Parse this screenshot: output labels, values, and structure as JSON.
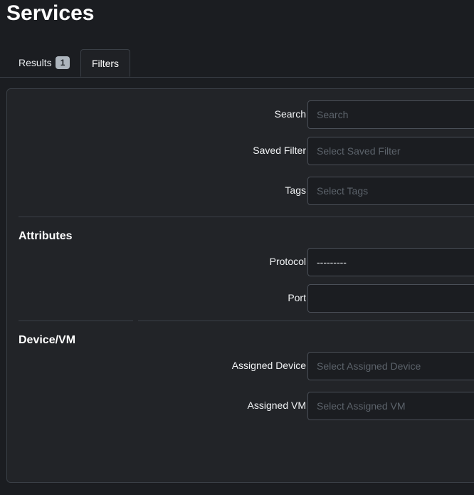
{
  "page": {
    "title": "Services"
  },
  "tabs": [
    {
      "label": "Results",
      "badge": "1"
    },
    {
      "label": "Filters"
    }
  ],
  "filters": {
    "search": {
      "label": "Search",
      "placeholder": "Search"
    },
    "saved_filter": {
      "label": "Saved Filter",
      "placeholder": "Select Saved Filter"
    },
    "tags": {
      "label": "Tags",
      "placeholder": "Select Tags"
    }
  },
  "attributes": {
    "heading": "Attributes",
    "protocol": {
      "label": "Protocol",
      "value": "---------"
    },
    "port": {
      "label": "Port",
      "value": ""
    }
  },
  "device_vm": {
    "heading": "Device/VM",
    "assigned_device": {
      "label": "Assigned Device",
      "placeholder": "Select Assigned Device"
    },
    "assigned_vm": {
      "label": "Assigned VM",
      "placeholder": "Select Assigned VM"
    }
  },
  "colors": {
    "background": "#1b1d21",
    "card": "#222428",
    "border": "#3a3f46",
    "badge": "#adb5bd"
  }
}
